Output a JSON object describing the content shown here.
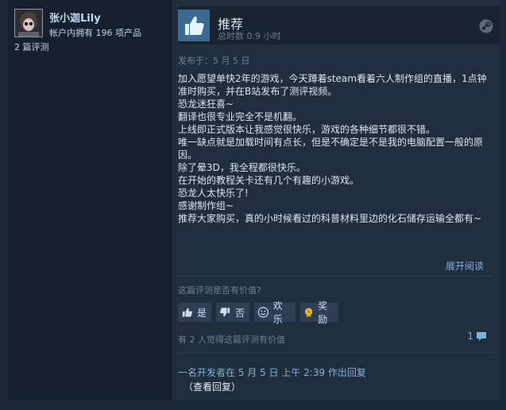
{
  "reviewer": {
    "name": "张小迦Lily",
    "products_owned": "帐户内拥有 196 项产品",
    "review_count": "2 篇评测"
  },
  "review": {
    "verdict": "推荐",
    "hours": "总时数 0.9 小时",
    "posted": "发布于：5 月 5 日",
    "lines": [
      "加入愿望单快2年的游戏，今天蹲着steam看着六人制作组的直播，1点钟准时购买，并在B站发布了测评视频。",
      "恐龙迷狂喜~",
      "翻译也很专业完全不是机翻。",
      "上线即正式版本让我感觉很快乐，游戏的各种细节都很不错。",
      "唯一缺点就是加载时间有点长，但是不确定是不是我的电脑配置一般的原因。",
      "除了晕3D，我全程都很快乐。",
      "在开始的教程关卡还有几个有趣的小游戏。",
      "恐龙人太快乐了!",
      "感谢制作组~",
      "推荐大家购买，真的小时候看过的科普材料里边的化石储存运输全都有~"
    ],
    "expand_label": "展开阅读"
  },
  "helpful": {
    "question": "这篇评测是否有价值?",
    "yes_label": "是",
    "no_label": "否",
    "funny_label": "欢乐",
    "award_label": "奖励",
    "found_helpful": "有 2 人觉得这篇评测有价值",
    "comment_count": "1"
  },
  "developer": {
    "response": "一名开发者在 5 月 5 日 上午 2:39 作出回复",
    "view_label": "（查看回复）"
  },
  "colors": {
    "background": "#1b2838",
    "card": "#1f2d3d",
    "thumb_box": "#3b6a91",
    "link": "#7eb3d8"
  },
  "icons": [
    "avatar",
    "thumbs-up-icon",
    "steam-icon",
    "thumbs-down-icon",
    "smiley-icon",
    "award-icon",
    "comment-icon"
  ]
}
